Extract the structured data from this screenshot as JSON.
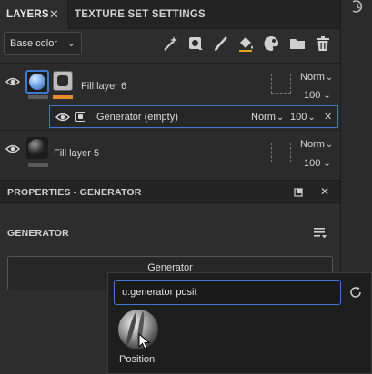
{
  "tabs": {
    "layers": "LAYERS",
    "layers_close": "✕",
    "texture_set_settings": "TEXTURE SET SETTINGS"
  },
  "toolbar": {
    "channel_value": "Base color",
    "tools": [
      "magic-wand-icon",
      "mask-add-icon",
      "paint-brush-icon",
      "fill-bucket-icon",
      "palette-icon",
      "folder-icon",
      "trash-icon"
    ]
  },
  "layers": [
    {
      "name": "Fill layer 6",
      "blend": "Norm",
      "opacity": "100",
      "effects": [
        {
          "name": "Generator (empty)",
          "blend": "Norm",
          "opacity": "100"
        }
      ]
    },
    {
      "name": "Fill layer 5",
      "blend": "Norm",
      "opacity": "100"
    }
  ],
  "properties": {
    "title": "PROPERTIES - GENERATOR",
    "section_title": "GENERATOR",
    "generator_button_label": "Generator"
  },
  "popup": {
    "search_value": "u:generator posit",
    "results": [
      {
        "label": "Position"
      }
    ]
  },
  "colors": {
    "accent_blue": "#3f7ad2",
    "orange_bar": "#e68a2e",
    "panel": "#2b2b2b"
  }
}
